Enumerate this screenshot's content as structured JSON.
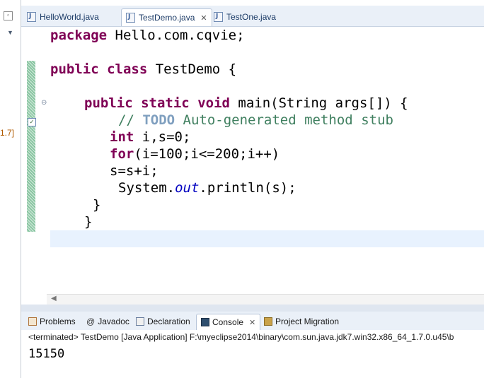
{
  "editor": {
    "tabs": [
      {
        "label": "HelloWorld.java",
        "active": false
      },
      {
        "label": "TestDemo.java",
        "active": true,
        "close": "✕"
      },
      {
        "label": "TestOne.java",
        "active": false
      }
    ],
    "code": {
      "line1": {
        "kw": "package",
        "rest": " Hello.com.cqvie;"
      },
      "line2": {
        "kw1": "public",
        "kw2": "class",
        "rest": " TestDemo {"
      },
      "line3": {
        "kw1": "public",
        "kw2": "static",
        "kw3": "void",
        "rest": " main(String args[]) {"
      },
      "line4": {
        "slashes": "// ",
        "todo": "TODO",
        "rest": " Auto-generated method stub"
      },
      "line5": {
        "kw": "int",
        "rest": " i,s=0;"
      },
      "line6": {
        "kw": "for",
        "rest": "(i=100;i<=200;i++)"
      },
      "line7": {
        "text": "s=s+i;"
      },
      "line8": {
        "pre": "System.",
        "field": "out",
        "post": ".println(s);"
      },
      "line9": {
        "text": "}"
      },
      "line10": {
        "text": "}"
      }
    }
  },
  "left_strip": {
    "fragment": "1.7]"
  },
  "console": {
    "tabs": [
      {
        "label": "Problems",
        "active": false,
        "icon": "problems-icon"
      },
      {
        "label": "Javadoc",
        "active": false,
        "icon": "at-icon",
        "glyph": "@"
      },
      {
        "label": "Declaration",
        "active": false,
        "icon": "declaration-icon"
      },
      {
        "label": "Console",
        "active": true,
        "icon": "console-icon",
        "close": "✕"
      },
      {
        "label": "Project Migration",
        "active": false,
        "icon": "migration-icon"
      }
    ],
    "status": "<terminated> TestDemo [Java Application] F:\\myeclipse2014\\binary\\com.sun.java.jdk7.win32.x86_64_1.7.0.u45\\b",
    "output": "15150"
  },
  "colors": {
    "keyword": "#7f0055",
    "comment": "#3f7f5f",
    "todo": "#7f9fbf",
    "static_field": "#0000c0",
    "current_line": "#e8f2fe"
  }
}
